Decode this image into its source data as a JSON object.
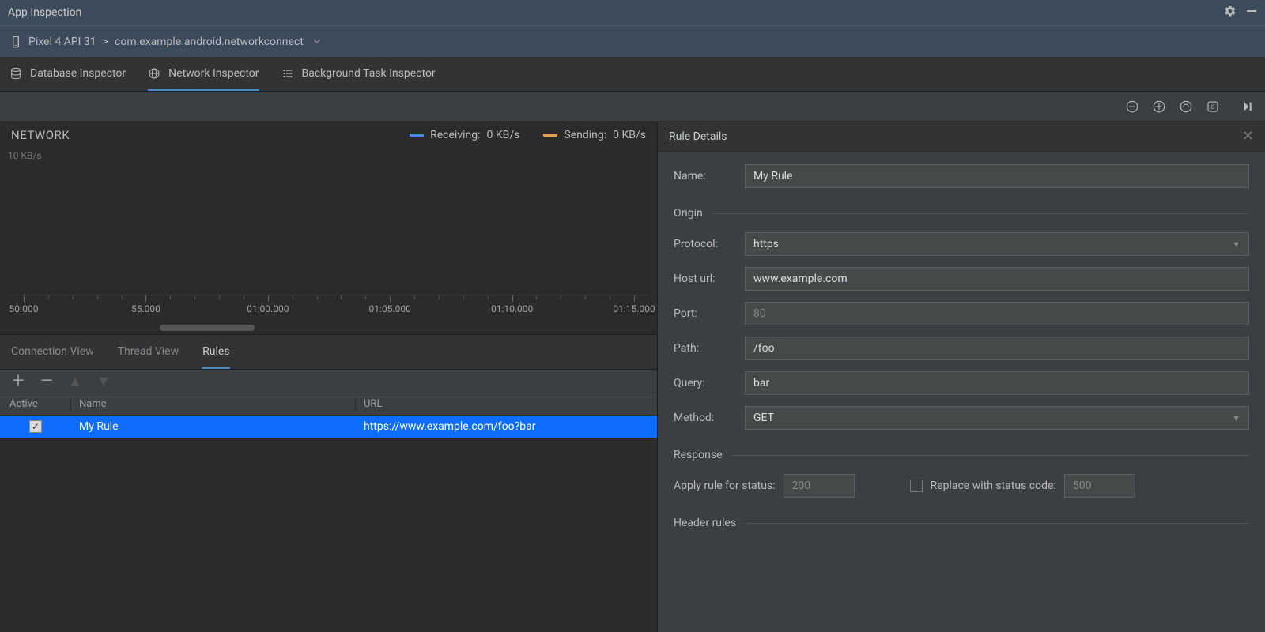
{
  "title_bar": {
    "title": "App Inspection"
  },
  "device_row": {
    "device": "Pixel 4 API 31",
    "separator": ">",
    "process": "com.example.android.networkconnect"
  },
  "tabs": {
    "database": "Database Inspector",
    "network": "Network Inspector",
    "background": "Background Task Inspector"
  },
  "network_chart": {
    "title": "NETWORK",
    "ylabel": "10 KB/s",
    "legend": {
      "receiving_label": "Receiving:",
      "receiving_value": "0 KB/s",
      "receiving_color": "#4a88f0",
      "sending_label": "Sending:",
      "sending_value": "0 KB/s",
      "sending_color": "#e0a050"
    },
    "ticks": [
      "50.000",
      "55.000",
      "01:00.000",
      "01:05.000",
      "01:10.000",
      "01:15.000"
    ]
  },
  "lower_tabs": {
    "connection": "Connection View",
    "thread": "Thread View",
    "rules": "Rules"
  },
  "rules_table": {
    "headers": {
      "active": "Active",
      "name": "Name",
      "url": "URL"
    },
    "rows": [
      {
        "active": true,
        "name": "My Rule",
        "url": "https://www.example.com/foo?bar"
      }
    ]
  },
  "rule_details": {
    "title": "Rule Details",
    "name_label": "Name:",
    "name_value": "My Rule",
    "origin_section": "Origin",
    "protocol_label": "Protocol:",
    "protocol_value": "https",
    "host_label": "Host url:",
    "host_value": "www.example.com",
    "port_label": "Port:",
    "port_placeholder": "80",
    "path_label": "Path:",
    "path_value": "/foo",
    "query_label": "Query:",
    "query_value": "bar",
    "method_label": "Method:",
    "method_value": "GET",
    "response_section": "Response",
    "apply_status_label": "Apply rule for status:",
    "apply_status_placeholder": "200",
    "replace_status_label": "Replace with status code:",
    "replace_status_placeholder": "500",
    "header_rules_section": "Header rules"
  }
}
